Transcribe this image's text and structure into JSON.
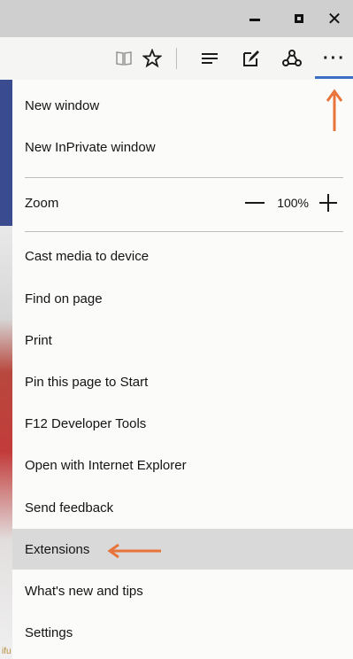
{
  "window": {
    "minimize_icon": "minimize-icon",
    "maximize_icon": "maximize-icon",
    "close_icon": "close-icon",
    "close_glyph": "✕"
  },
  "toolbar": {
    "icons": [
      "reading-view-icon",
      "favorite-star-icon",
      "hub-icon",
      "web-note-icon",
      "share-icon",
      "more-actions-icon"
    ],
    "more_glyph": "···",
    "star_glyph": "★",
    "accent": "#3c6fc4"
  },
  "menu": {
    "new_window": "New window",
    "new_inprivate_window": "New InPrivate window",
    "zoom_label": "Zoom",
    "zoom_value": "100%",
    "cast_media": "Cast media to device",
    "find_on_page": "Find on page",
    "print": "Print",
    "pin_to_start": "Pin this page to Start",
    "dev_tools": "F12 Developer Tools",
    "open_with_ie": "Open with Internet Explorer",
    "send_feedback": "Send feedback",
    "extensions": "Extensions",
    "whats_new": "What's new and tips",
    "settings": "Settings"
  },
  "annotation": {
    "arrow_color": "#e8743b"
  },
  "page_edge": {
    "text": "ifu"
  }
}
